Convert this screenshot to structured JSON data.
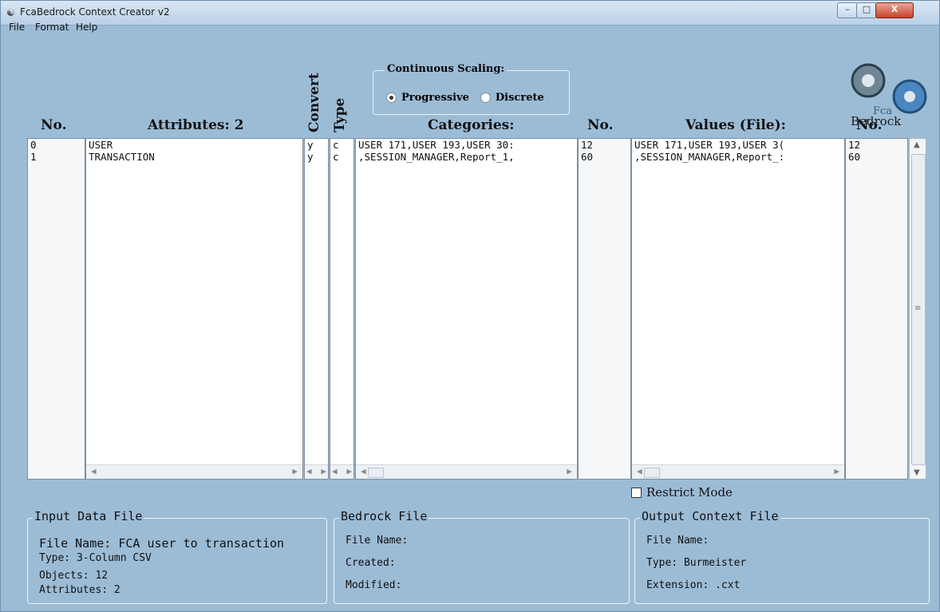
{
  "window": {
    "title": "FcaBedrock Context Creator v2",
    "controls": {
      "minimize": "–",
      "maximize": "□",
      "close": "X"
    }
  },
  "menu": {
    "file": "File",
    "format": "Format",
    "help": "Help"
  },
  "headers": {
    "no_left": "No.",
    "attributes": "Attributes: 2",
    "convert": "Convert",
    "type": "Type",
    "categories": "Categories:",
    "no_mid": "No.",
    "values": "Values (File):",
    "no_right": "No."
  },
  "scaling": {
    "legend": "Continuous Scaling:",
    "options": [
      "Progressive",
      "Discrete"
    ],
    "selected": "Progressive"
  },
  "logo": {
    "text_top": "Fca",
    "text_bottom": "Bedrock"
  },
  "table": {
    "rows": [
      {
        "no": "0",
        "attribute": "USER",
        "convert": "y",
        "type": "c",
        "categories": "USER 171,USER 193,USER 30:",
        "cat_count": "12",
        "values": "USER 171,USER 193,USER 3(",
        "val_count": "12"
      },
      {
        "no": "1",
        "attribute": "TRANSACTION",
        "convert": "y",
        "type": "c",
        "categories": ",SESSION_MANAGER,Report_1,",
        "cat_count": "60",
        "values": ",SESSION_MANAGER,Report_:",
        "val_count": "60"
      }
    ]
  },
  "restrict_mode": {
    "label": "Restrict Mode",
    "checked": false
  },
  "input_file": {
    "legend": "Input Data File",
    "file_name": "File Name: FCA user to transaction",
    "type": "Type: 3-Column CSV",
    "objects": "Objects: 12",
    "attributes": "Attributes: 2"
  },
  "bedrock_file": {
    "legend": "Bedrock File",
    "file_name": "File Name:",
    "created": "Created:",
    "modified": "Modified:"
  },
  "output_file": {
    "legend": "Output Context File",
    "file_name": "File Name:",
    "type": "Type: Burmeister",
    "extension": "Extension: .cxt"
  }
}
